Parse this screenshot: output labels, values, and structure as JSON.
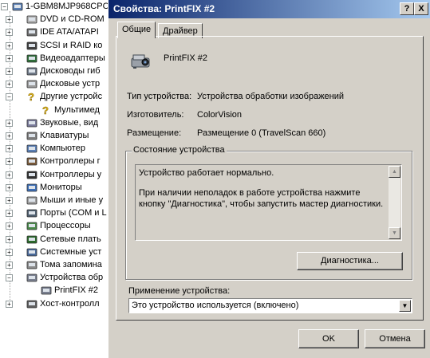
{
  "tree": {
    "items": [
      {
        "label": "1-GBM8MJP968CPC",
        "icon": "computer-icon",
        "expander": "−"
      },
      {
        "label": "DVD и CD-ROM",
        "icon": "cdrom-icon",
        "expander": "+"
      },
      {
        "label": "IDE ATA/ATAPI",
        "icon": "ide-controller-icon",
        "expander": "+"
      },
      {
        "label": "SCSI и RAID ко",
        "icon": "scsi-icon",
        "expander": "+"
      },
      {
        "label": "Видеоадаптеры",
        "icon": "display-adapter-icon",
        "expander": "+"
      },
      {
        "label": "Дисководы гиб",
        "icon": "floppy-icon",
        "expander": "+"
      },
      {
        "label": "Дисковые устр",
        "icon": "disk-drive-icon",
        "expander": "+"
      },
      {
        "label": "Другие устройс",
        "icon": "unknown-device-icon",
        "expander": "−"
      },
      {
        "label": "Мультимед",
        "icon": "warning-device-icon",
        "expander": ""
      },
      {
        "label": "Звуковые, вид",
        "icon": "sound-icon",
        "expander": "+"
      },
      {
        "label": "Клавиатуры",
        "icon": "keyboard-icon",
        "expander": "+"
      },
      {
        "label": "Компьютер",
        "icon": "computer-icon",
        "expander": "+"
      },
      {
        "label": "Контроллеры г",
        "icon": "controller-icon",
        "expander": "+"
      },
      {
        "label": "Контроллеры у",
        "icon": "usb-icon",
        "expander": "+"
      },
      {
        "label": "Мониторы",
        "icon": "monitor-icon",
        "expander": "+"
      },
      {
        "label": "Мыши и иные у",
        "icon": "mouse-icon",
        "expander": "+"
      },
      {
        "label": "Порты (COM и L",
        "icon": "port-icon",
        "expander": "+"
      },
      {
        "label": "Процессоры",
        "icon": "processor-icon",
        "expander": "+"
      },
      {
        "label": "Сетевые плать",
        "icon": "network-card-icon",
        "expander": "+"
      },
      {
        "label": "Системные уст",
        "icon": "system-device-icon",
        "expander": "+"
      },
      {
        "label": "Тома запомина",
        "icon": "storage-volume-icon",
        "expander": "+"
      },
      {
        "label": "Устройства обр",
        "icon": "imaging-device-icon",
        "expander": "−"
      },
      {
        "label": "PrintFIX #2",
        "icon": "scanner-icon",
        "expander": ""
      },
      {
        "label": "Хост-контролл",
        "icon": "host-controller-icon",
        "expander": "+"
      }
    ]
  },
  "dialog": {
    "title": "Свойства: PrintFIX #2",
    "help_button": "?",
    "close_button": "X",
    "tabs": [
      {
        "label": "Общие",
        "active": true
      },
      {
        "label": "Драйвер",
        "active": false
      }
    ],
    "device_name": "PrintFIX #2",
    "device_icon": "scanner-icon",
    "fields": [
      {
        "label": "Тип устройства:",
        "value": "Устройства обработки изображений"
      },
      {
        "label": "Изготовитель:",
        "value": "ColorVision"
      },
      {
        "label": "Размещение:",
        "value": "Размещение 0 (TravelScan 660)"
      }
    ],
    "status_group": {
      "title": "Состояние устройства",
      "line1": "Устройство работает нормально.",
      "line2": "При наличии неполадок в работе устройства нажмите кнопку \"Диагностика\", чтобы запустить мастер диагностики."
    },
    "diagnostics_button": "Диагностика...",
    "usage": {
      "label": "Применение устройства:",
      "selected": "Это устройство используется (включено)"
    },
    "ok_button": "OK",
    "cancel_button": "Отмена"
  }
}
